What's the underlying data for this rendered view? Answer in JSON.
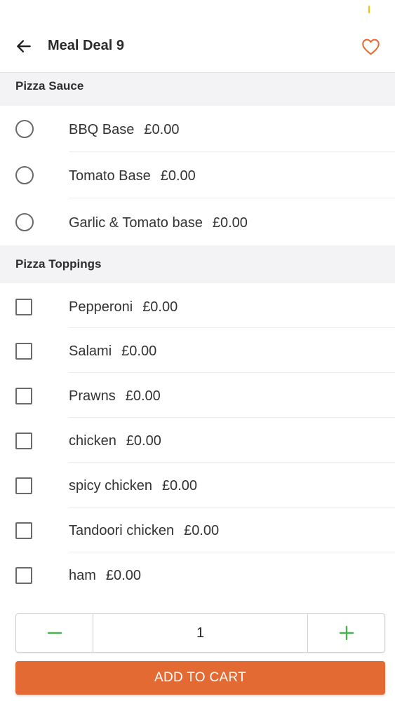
{
  "header": {
    "title": "Meal Deal 9",
    "back_icon": "back-arrow-icon",
    "favorite_icon": "heart-icon"
  },
  "sections": [
    {
      "title": "Pizza Sauce",
      "type": "radio",
      "options": [
        {
          "label": "BBQ Base",
          "price": "£0.00",
          "selected": false
        },
        {
          "label": "Tomato Base",
          "price": "£0.00",
          "selected": false
        },
        {
          "label": "Garlic & Tomato base",
          "price": "£0.00",
          "selected": false
        }
      ]
    },
    {
      "title": "Pizza Toppings",
      "type": "checkbox",
      "options": [
        {
          "label": "Pepperoni",
          "price": "£0.00",
          "checked": false
        },
        {
          "label": "Salami",
          "price": "£0.00",
          "checked": false
        },
        {
          "label": "Prawns",
          "price": "£0.00",
          "checked": false
        },
        {
          "label": "chicken",
          "price": "£0.00",
          "checked": false
        },
        {
          "label": "spicy chicken",
          "price": "£0.00",
          "checked": false
        },
        {
          "label": "Tandoori chicken",
          "price": "£0.00",
          "checked": false
        },
        {
          "label": "ham",
          "price": "£0.00",
          "checked": false
        }
      ]
    }
  ],
  "quantity": {
    "value": "1",
    "decrement_label": "−",
    "increment_label": "+"
  },
  "add_to_cart_label": "ADD TO CART",
  "colors": {
    "accent": "#e46a34",
    "stepper_icon": "#4caf50",
    "section_bg": "#f3f3f5",
    "control_border": "#6a6a6a"
  }
}
